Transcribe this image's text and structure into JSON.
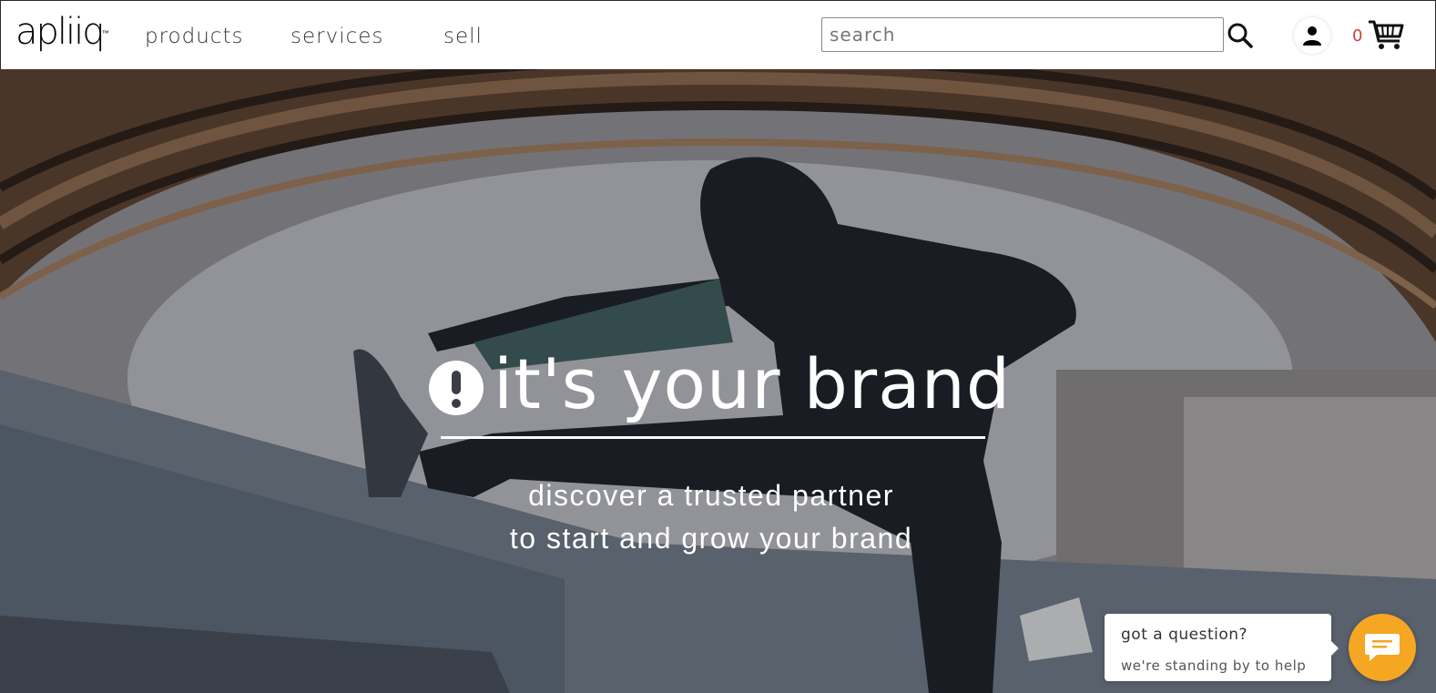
{
  "header": {
    "logo_text": "apliiq",
    "logo_tm": "™",
    "nav": [
      {
        "label": "products"
      },
      {
        "label": "services"
      },
      {
        "label": "sell"
      }
    ],
    "search": {
      "placeholder": "search",
      "value": ""
    },
    "search_icon": "search-icon",
    "account_icon": "user-icon",
    "cart": {
      "count": "0",
      "icon": "cart-icon"
    }
  },
  "hero": {
    "headline_icon": "exclamation-circle-icon",
    "headline": "it's your brand",
    "subline_1": "discover a trusted partner",
    "subline_2": "to start and grow your brand"
  },
  "chat": {
    "title": "got a question?",
    "subtitle": "we're standing by to help",
    "launcher_icon": "chat-icon",
    "accent": "#f5a623"
  }
}
